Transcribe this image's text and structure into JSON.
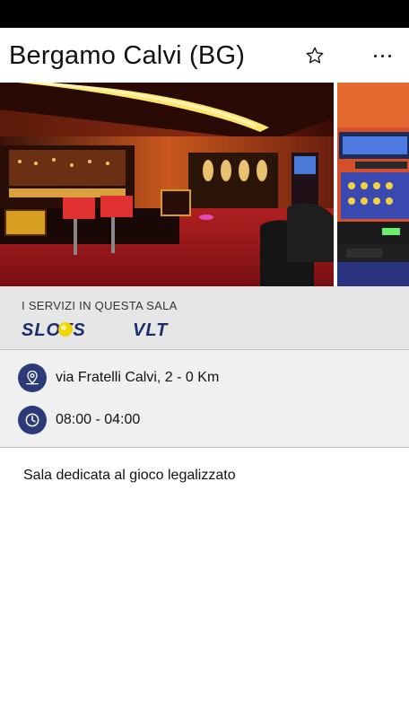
{
  "header": {
    "title": "Bergamo Calvi (BG)"
  },
  "services": {
    "label": "I SERVIZI IN QUESTA SALA",
    "items": [
      "SLOTS",
      "VLT"
    ]
  },
  "info": {
    "address": "via Fratelli Calvi, 2  - 0 Km",
    "hours": "08:00 - 04:00"
  },
  "description": "Sala dedicata al gioco legalizzato",
  "colors": {
    "status_bar": "#000000",
    "services_bg": "#e6e6e6",
    "info_bg": "#f0f0f0",
    "icon_circle": "#2b3a78",
    "logo_navy": "#1c2d6b",
    "logo_yellow": "#f4d400"
  },
  "icons": [
    "star-icon",
    "more-icon",
    "location-icon",
    "clock-icon"
  ]
}
